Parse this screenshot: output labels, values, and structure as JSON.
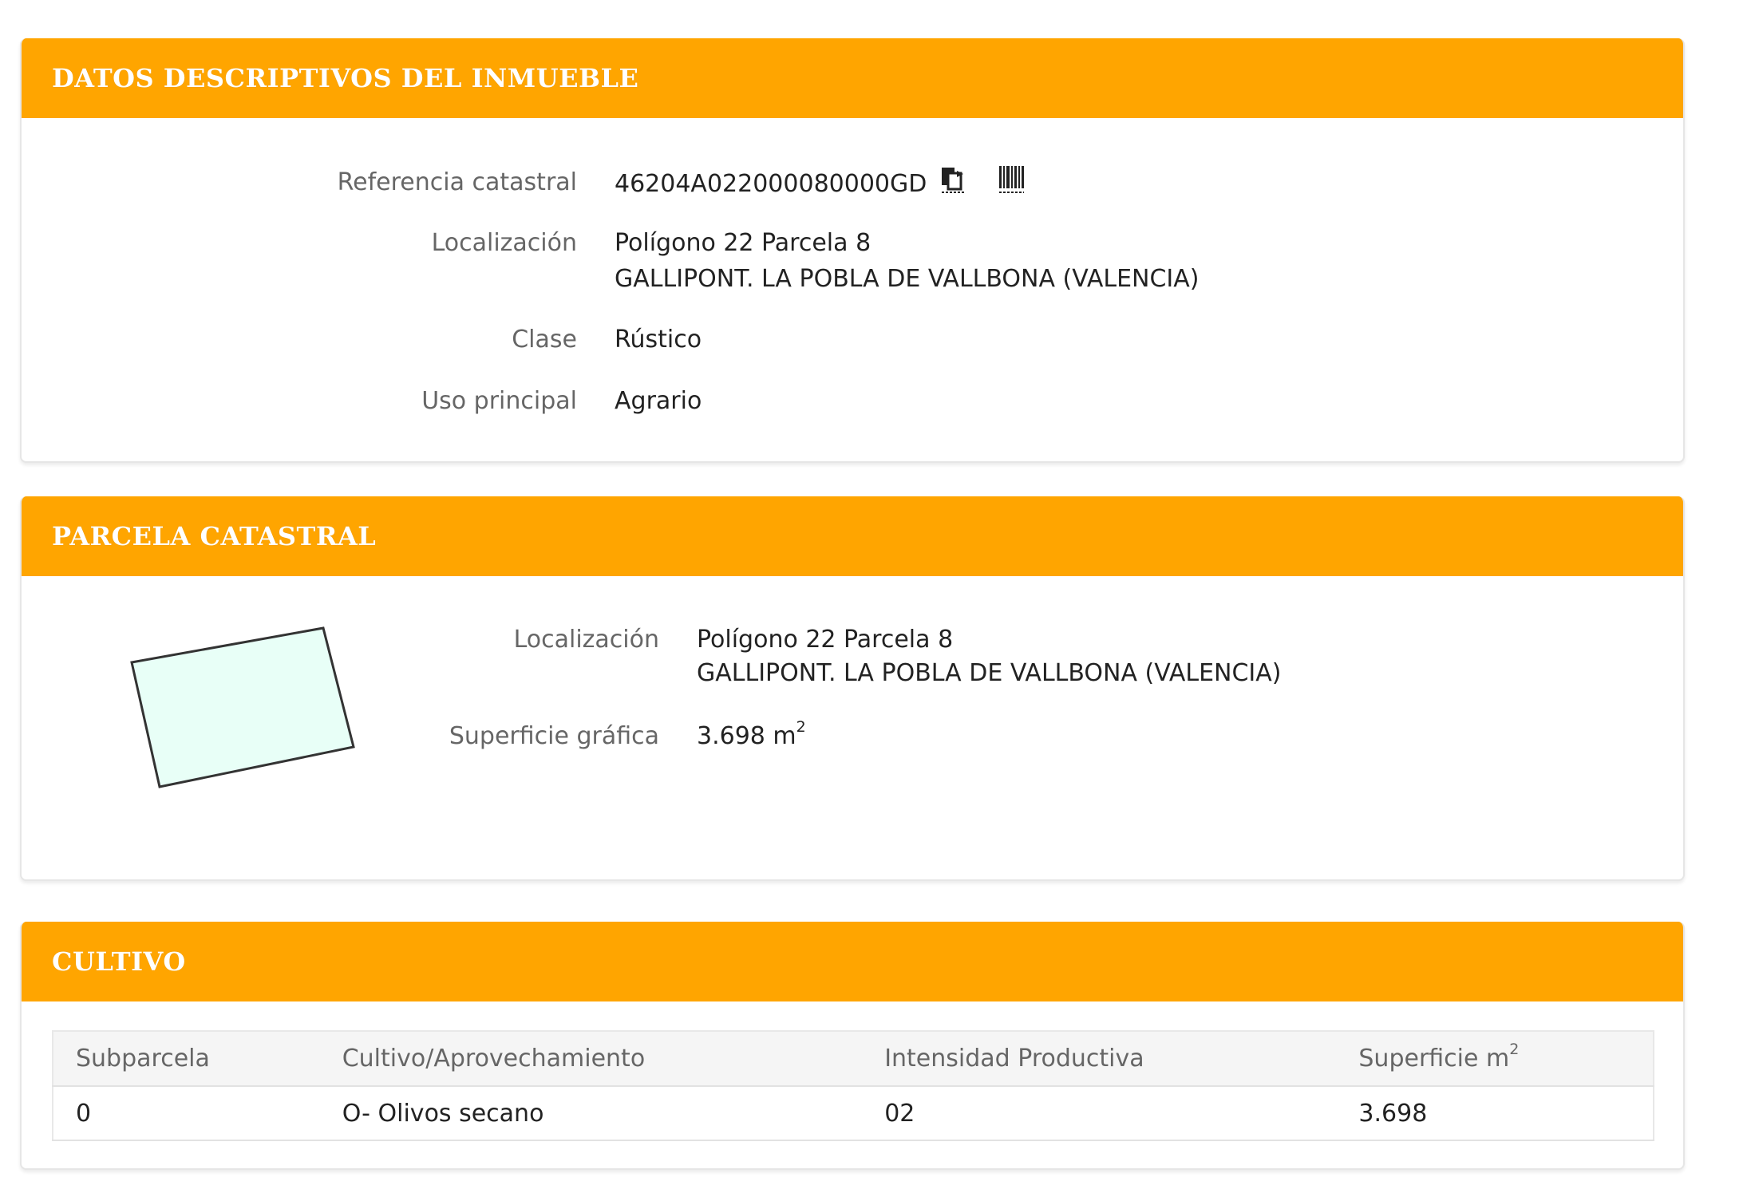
{
  "sections": {
    "datos": {
      "title": "DATOS DESCRIPTIVOS DEL INMUEBLE",
      "referencia_label": "Referencia catastral",
      "referencia_value": "46204A022000080000GD",
      "localizacion_label": "Localización",
      "localizacion_line1": "Polígono 22 Parcela 8",
      "localizacion_line2": "GALLIPONT. LA POBLA DE VALLBONA (VALENCIA)",
      "clase_label": "Clase",
      "clase_value": "Rústico",
      "uso_label": "Uso principal",
      "uso_value": "Agrario"
    },
    "parcela": {
      "title": "PARCELA CATASTRAL",
      "localizacion_label": "Localización",
      "localizacion_line1": "Polígono 22 Parcela 8",
      "localizacion_line2": "GALLIPONT. LA POBLA DE VALLBONA (VALENCIA)",
      "superficie_label": "Superficie gráfica",
      "superficie_value": "3.698 m",
      "superficie_unit_sup": "2"
    },
    "cultivo": {
      "title": "CULTIVO",
      "headers": [
        "Subparcela",
        "Cultivo/Aprovechamiento",
        "Intensidad Productiva",
        "Superficie m"
      ],
      "header_sup": "2",
      "rows": [
        [
          "0",
          "O- Olivos secano",
          "02",
          "3.698"
        ]
      ]
    }
  },
  "icons": {
    "copy": "copy-icon",
    "barcode": "barcode-icon"
  },
  "colors": {
    "header_orange": "#ffa500",
    "parcel_fill": "#e8fff7",
    "parcel_stroke": "#333333"
  }
}
